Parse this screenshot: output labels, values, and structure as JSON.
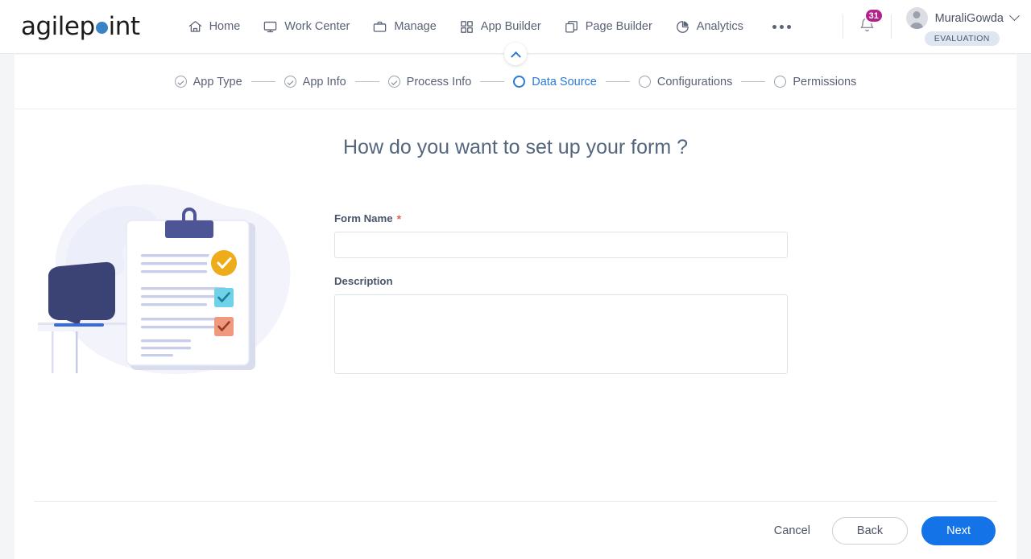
{
  "header": {
    "logo_text_a": "agilep",
    "logo_text_b": "int",
    "logo_dot_color": "#3b82c4",
    "nav": [
      {
        "label": "Home",
        "icon": "home-icon"
      },
      {
        "label": "Work Center",
        "icon": "monitor-icon"
      },
      {
        "label": "Manage",
        "icon": "briefcase-icon"
      },
      {
        "label": "App Builder",
        "icon": "grid-icon"
      },
      {
        "label": "Page Builder",
        "icon": "layers-icon"
      },
      {
        "label": "Analytics",
        "icon": "pie-chart-icon"
      }
    ],
    "more_menu": "more-horizontal-icon",
    "notifications": {
      "icon": "bell-icon",
      "count": "31",
      "badge_color": "#b3228c"
    },
    "user": {
      "name": "MuraliGowda",
      "avatar": "user-avatar-icon",
      "chevron": "chevron-down-icon",
      "plan_badge": "EVALUATION"
    }
  },
  "collapse": {
    "icon": "chevron-up-icon"
  },
  "stepper": {
    "steps": [
      {
        "label": "App Type",
        "state": "done"
      },
      {
        "label": "App Info",
        "state": "done"
      },
      {
        "label": "Process Info",
        "state": "done"
      },
      {
        "label": "Data Source",
        "state": "current"
      },
      {
        "label": "Configurations",
        "state": "todo"
      },
      {
        "label": "Permissions",
        "state": "todo"
      }
    ],
    "active_color": "#2a7ad6"
  },
  "main": {
    "title": "How do you want to set up your form ?",
    "illustration": "form-setup-clipboard-illustration",
    "fields": {
      "form_name": {
        "label": "Form Name",
        "required_marker": "*",
        "value": "",
        "placeholder": ""
      },
      "description": {
        "label": "Description",
        "value": "",
        "placeholder": ""
      }
    }
  },
  "footer": {
    "cancel_label": "Cancel",
    "back_label": "Back",
    "next_label": "Next",
    "next_color": "#1473e6"
  }
}
